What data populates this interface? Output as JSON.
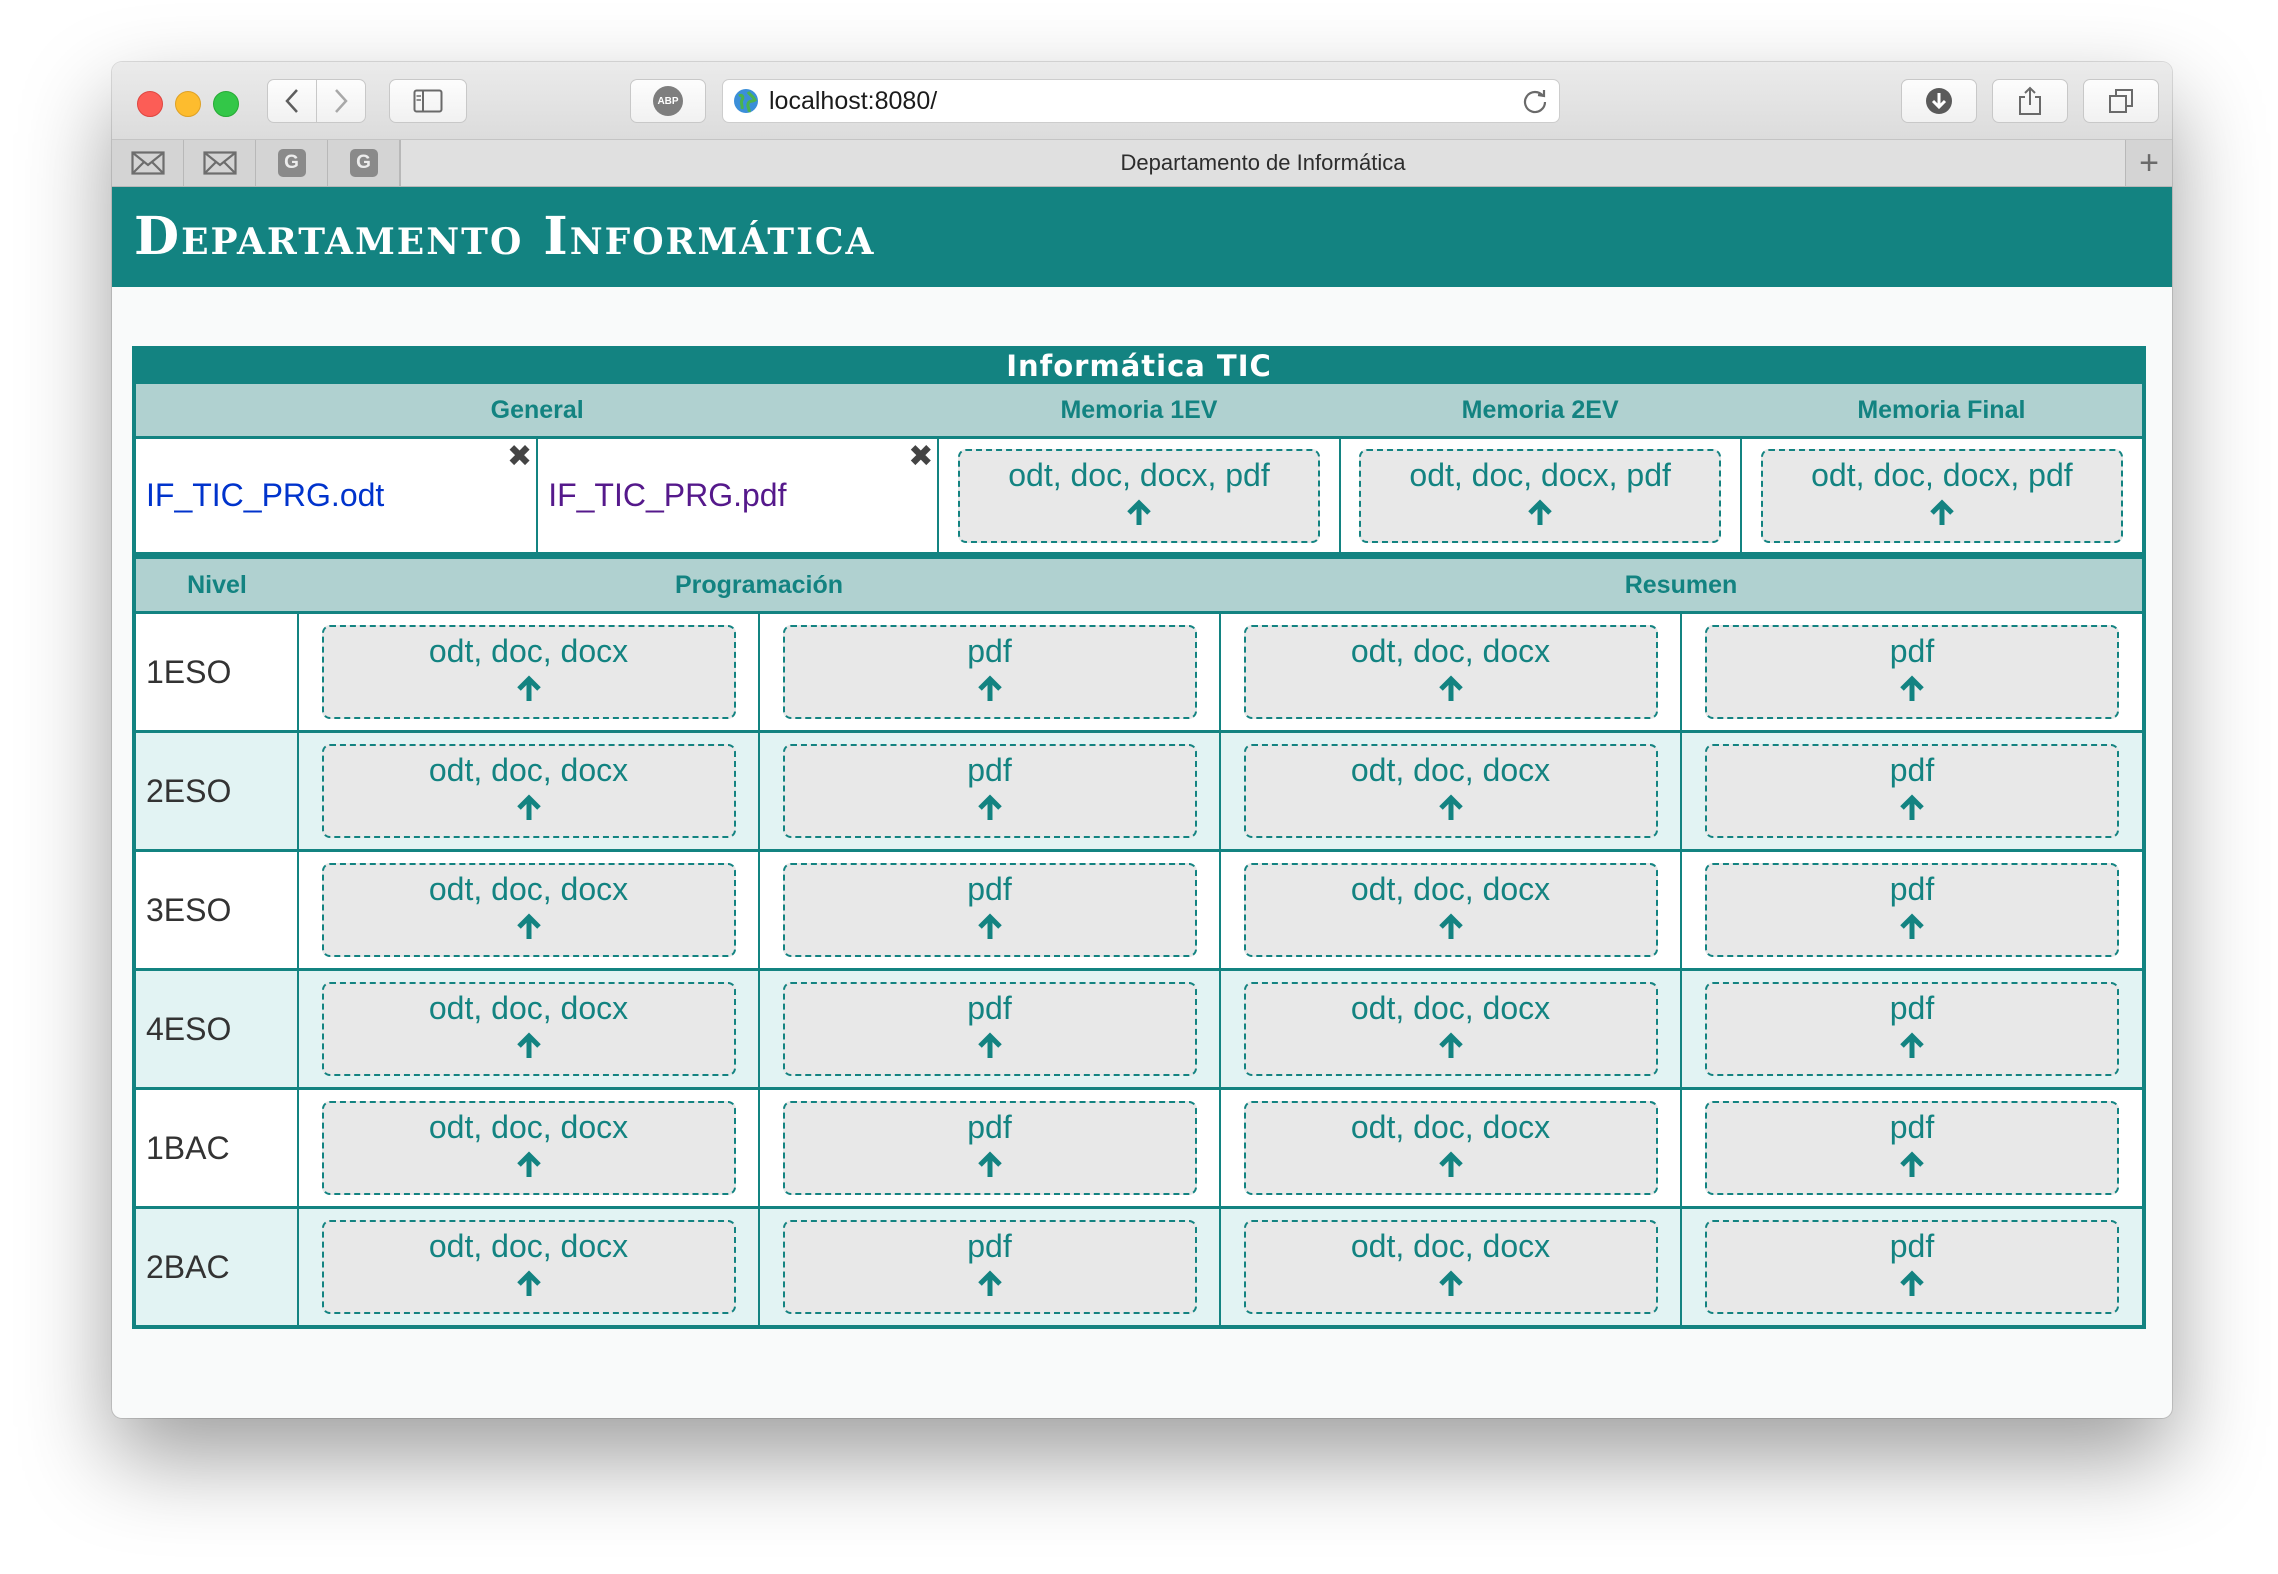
{
  "browser": {
    "url": "localhost:8080/",
    "tab_title": "Departamento de Informática",
    "new_tab": "+",
    "pinned_tabs": [
      {
        "icon": "mail-icon"
      },
      {
        "icon": "mail-icon"
      },
      {
        "icon": "g-icon",
        "letter": "G"
      },
      {
        "icon": "g-icon",
        "letter": "G"
      }
    ],
    "abp_label": "ABP"
  },
  "site": {
    "title": "Departamento Informática"
  },
  "panel": {
    "title": "Informática TIC",
    "top_headers": [
      "General",
      "Memoria 1EV",
      "Memoria 2EV",
      "Memoria Final"
    ],
    "general_files": [
      "IF_TIC_PRG.odt",
      "IF_TIC_PRG.pdf"
    ],
    "delete_glyph": "✖",
    "memoria_upload_label": "odt, doc, docx, pdf",
    "level_headers": {
      "nivel": "Nivel",
      "programacion": "Programación",
      "resumen": "Resumen"
    },
    "upload_labels": {
      "doc": "odt, doc, docx",
      "pdf": "pdf"
    },
    "levels": [
      "1ESO",
      "2ESO",
      "3ESO",
      "4ESO",
      "1BAC",
      "2BAC"
    ]
  },
  "colors": {
    "accent": "#138381",
    "header_bg": "#b0d1d0",
    "drop_bg": "#e8e8e8",
    "alt_row": "#e2f3f3"
  }
}
